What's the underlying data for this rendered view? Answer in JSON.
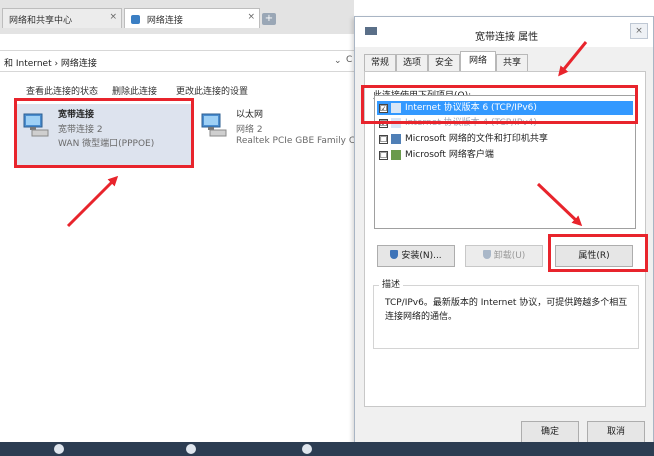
{
  "explorer": {
    "tabs": [
      {
        "label": "网络和共享中心",
        "close": "×"
      },
      {
        "label": "网络连接",
        "close": "×"
      }
    ],
    "new_tab": "+",
    "address": {
      "path": "和 Internet  ›  网络连接",
      "dropdown": "⌄",
      "refresh": "C"
    },
    "commands": [
      {
        "label": "查看此连接的状态"
      },
      {
        "label": "删除此连接"
      },
      {
        "label": "更改此连接的设置"
      }
    ],
    "connections": [
      {
        "name": "宽带连接",
        "line1": "宽带连接 2",
        "line2": "WAN 微型端口(PPPOE)"
      },
      {
        "name": "以太网",
        "line1": "网络 2",
        "line2": "Realtek PCIe GBE Family Con"
      }
    ]
  },
  "dialog": {
    "title": "宽带连接 属性",
    "close": "×",
    "tabs": [
      {
        "label": "常规"
      },
      {
        "label": "选项"
      },
      {
        "label": "安全"
      },
      {
        "label": "网络"
      },
      {
        "label": "共享"
      }
    ],
    "connect_label": "此连接使用下列项目(O):",
    "items": [
      {
        "label": "Internet 协议版本 6 (TCP/IPv6)",
        "checked": "☑",
        "selected": true
      },
      {
        "label": "Internet 协议版本 4 (TCP/IPv4)",
        "checked": "☑",
        "selected": false
      },
      {
        "label": "Microsoft 网络的文件和打印机共享",
        "checked": "☐",
        "selected": false
      },
      {
        "label": "Microsoft 网络客户端",
        "checked": "☐",
        "selected": false
      }
    ],
    "buttons": {
      "install": "安装(N)...",
      "uninstall": "卸载(U)",
      "properties": "属性(R)",
      "ok": "确定",
      "cancel": "取消"
    },
    "description_title": "描述",
    "description_text": "TCP/IPv6。最新版本的 Internet 协议，可提供跨越多个相互连接网络的通信。"
  },
  "colors": {
    "accent": "#e8242c",
    "selection": "#3399ff"
  }
}
